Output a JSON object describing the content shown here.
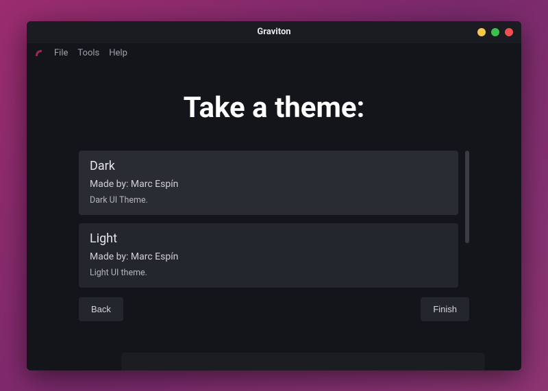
{
  "window": {
    "title": "Graviton"
  },
  "menubar": {
    "items": [
      {
        "label": "File"
      },
      {
        "label": "Tools"
      },
      {
        "label": "Help"
      }
    ]
  },
  "content": {
    "heading": "Take a theme:",
    "themes": [
      {
        "name": "Dark",
        "author_prefix": "Made by: ",
        "author": "Marc Espín",
        "description": "Dark UI Theme."
      },
      {
        "name": "Light",
        "author_prefix": "Made by: ",
        "author": "Marc Espín",
        "description": "Light UI theme."
      }
    ],
    "buttons": {
      "back": "Back",
      "finish": "Finish"
    }
  }
}
